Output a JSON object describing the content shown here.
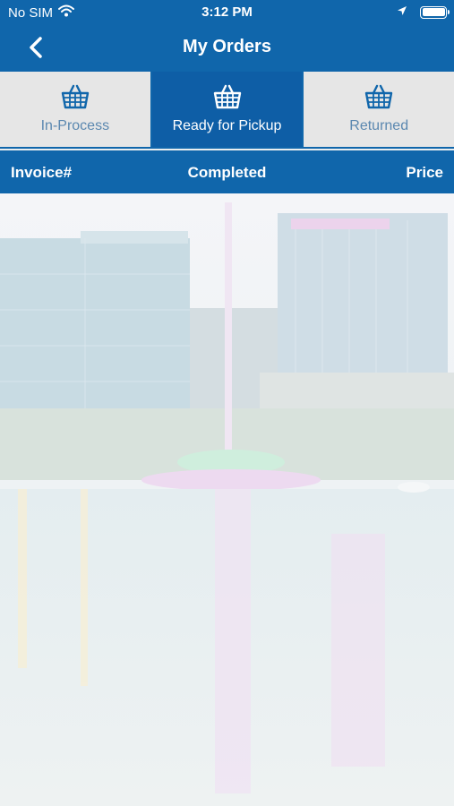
{
  "status_bar": {
    "carrier": "No SIM",
    "time": "3:12 PM"
  },
  "nav": {
    "title": "My Orders"
  },
  "tabs": [
    {
      "label": "In-Process",
      "active": false
    },
    {
      "label": "Ready for Pickup",
      "active": true
    },
    {
      "label": "Returned",
      "active": false
    }
  ],
  "table_header": {
    "invoice": "Invoice#",
    "completed": "Completed",
    "price": "Price"
  },
  "colors": {
    "primary": "#1066ab",
    "tab_active": "#0e5ea6",
    "tab_inactive": "#e6e6e6"
  }
}
